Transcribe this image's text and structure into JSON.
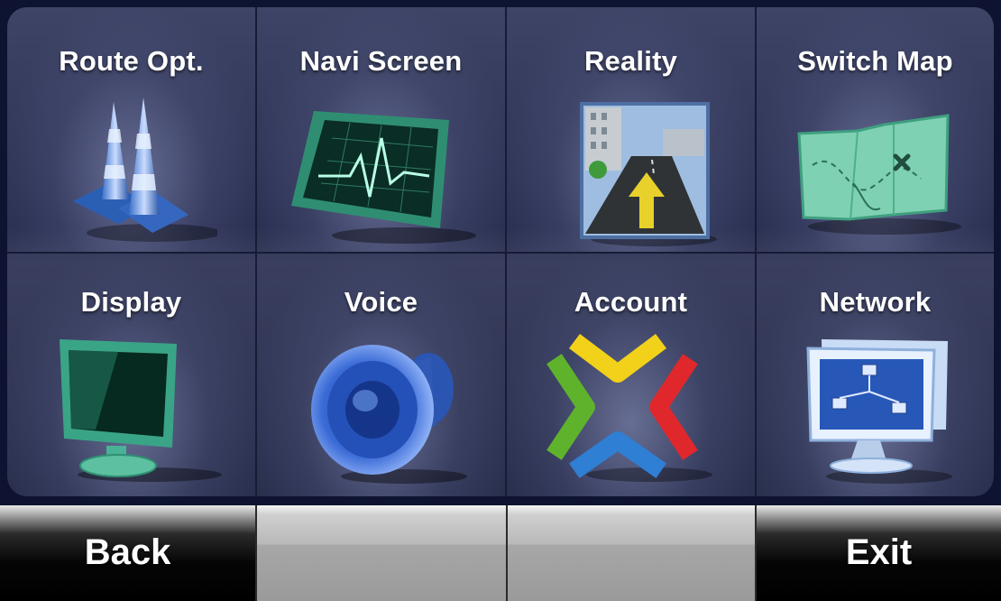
{
  "menu": {
    "tiles": [
      {
        "label": "Route Opt.",
        "icon": "traffic-cones-icon"
      },
      {
        "label": "Navi Screen",
        "icon": "heartbeat-monitor-icon"
      },
      {
        "label": "Reality",
        "icon": "road-arrow-icon"
      },
      {
        "label": "Switch Map",
        "icon": "treasure-map-icon"
      },
      {
        "label": "Display",
        "icon": "monitor-icon"
      },
      {
        "label": "Voice",
        "icon": "speaker-icon"
      },
      {
        "label": "Account",
        "icon": "account-arrows-icon"
      },
      {
        "label": "Network",
        "icon": "network-computer-icon"
      }
    ]
  },
  "bottom_bar": {
    "back_label": "Back",
    "exit_label": "Exit"
  },
  "colors": {
    "panel_bg": "#2b3052",
    "tile_label": "#ffffff",
    "green_screen": "#3fa889",
    "blue_accent": "#2f64c8",
    "yellow": "#f2d11a",
    "red": "#e0282c",
    "green": "#5fb32c"
  }
}
